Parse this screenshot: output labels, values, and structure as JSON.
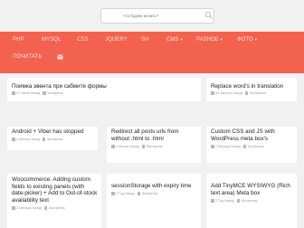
{
  "search": {
    "placeholder": "что будем искать?"
  },
  "nav": {
    "items": [
      {
        "label": "PHP"
      },
      {
        "label": "MYSQL"
      },
      {
        "label": "CSS"
      },
      {
        "label": "JQUERY"
      },
      {
        "label": "SH"
      },
      {
        "label": "CMS"
      },
      {
        "label": "РАЗНОЕ"
      },
      {
        "label": "ФОТО"
      },
      {
        "label": "ПОЧИТАТЬ"
      }
    ]
  },
  "cards": [
    {
      "title": [
        "Поимка эвента при сабмите формы"
      ],
      "meta_date": "07 Июня Назад",
      "meta_cat": "Wordpress"
    },
    {
      "title": [
        "Replace word's in translation"
      ],
      "meta_date": "09 Августа Назад",
      "meta_cat": "Wordpress"
    },
    {
      "title": [
        "Android + Viber has stopped"
      ],
      "meta_date": "1 Месяц Назад",
      "meta_cat": "Wordpress"
    },
    {
      "title": [
        "Redirect all posts urls from",
        "without .html to .html"
      ],
      "meta_date": "1 Месяц Назад",
      "meta_cat": "Wordpress"
    },
    {
      "title": [
        "Custom CSS and JS with",
        "WordPress meta box's"
      ],
      "meta_date": "2 Месяца Назад",
      "meta_cat": "Wordpress"
    },
    {
      "title": [
        "Woocommerce: Adding custom",
        "fields to existing panels (with",
        "date-picker) + Add to Out-of-stock",
        "availability text"
      ],
      "meta_date": "2 Месяца Назад",
      "meta_cat": "Wordpress"
    },
    {
      "title": [
        "sessionStorage with expiry time"
      ],
      "meta_date": "1 Год Назад",
      "meta_cat": "Wordpress"
    },
    {
      "title": [
        "Add TinyMCE WYSIWYG (Rich",
        "text area) Meta box"
      ],
      "meta_date": "1 Год Назад",
      "meta_cat": "Wordpress"
    }
  ],
  "colors": {
    "nav_bg": "#f3624f",
    "page_bg": "#f1f1f1",
    "card_bg": "#ffffff"
  },
  "icons": {
    "mail": "mail-icon",
    "search": "search-icon",
    "calendar": "calendar-icon",
    "folder": "folder-icon"
  }
}
